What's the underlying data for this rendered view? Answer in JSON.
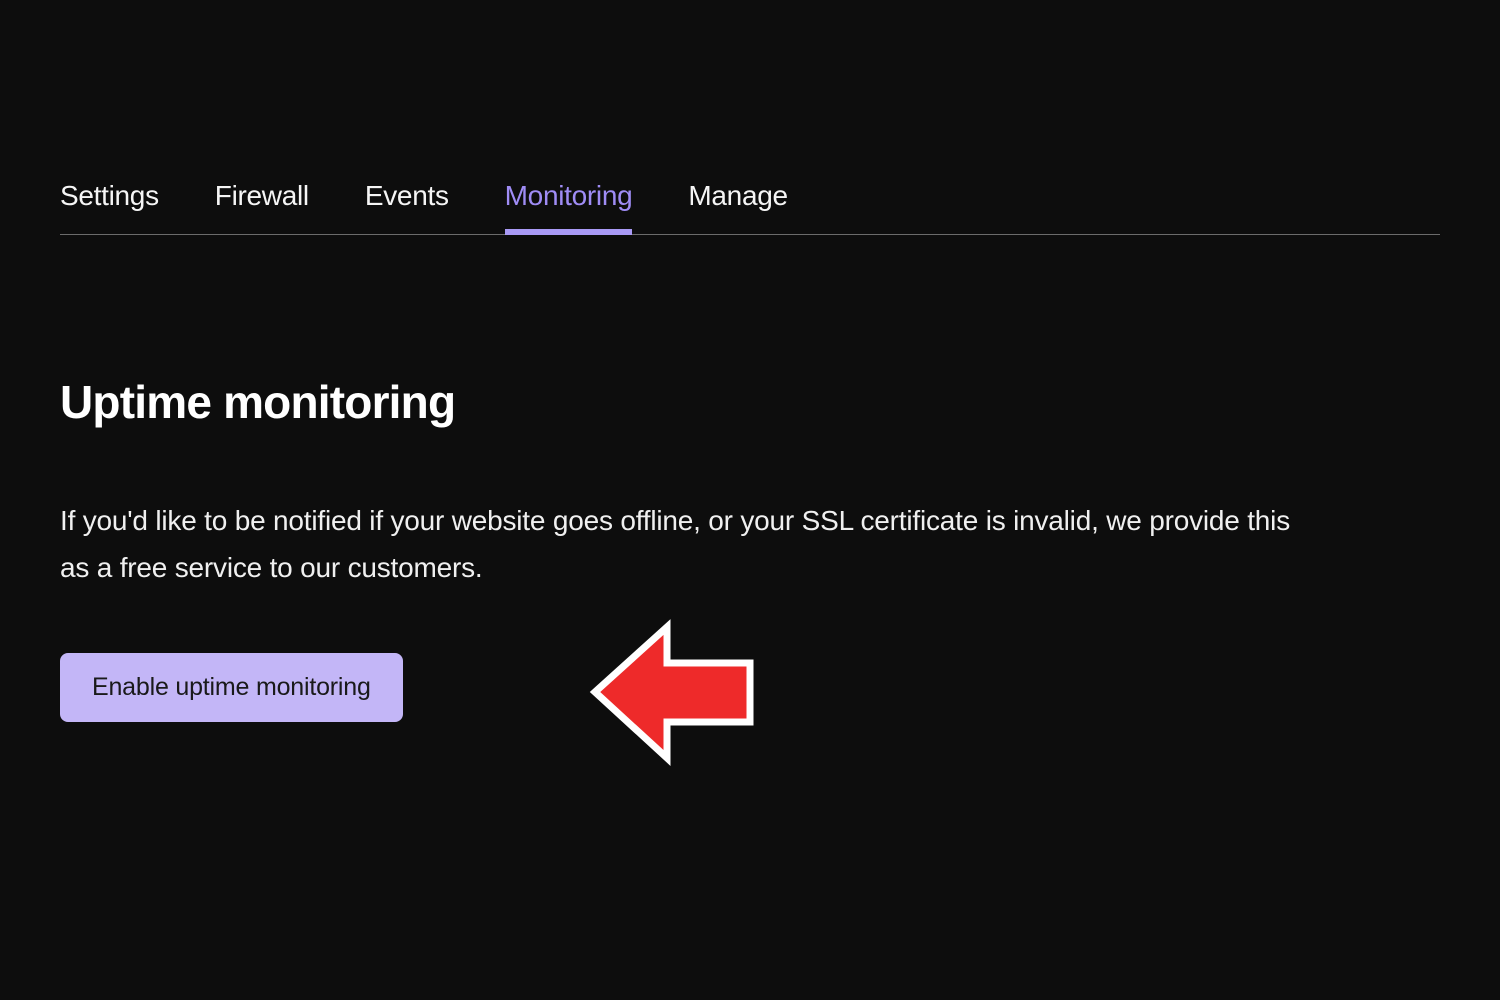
{
  "tabs": [
    {
      "label": "Settings",
      "active": false
    },
    {
      "label": "Firewall",
      "active": false
    },
    {
      "label": "Events",
      "active": false
    },
    {
      "label": "Monitoring",
      "active": true
    },
    {
      "label": "Manage",
      "active": false
    }
  ],
  "content": {
    "heading": "Uptime monitoring",
    "description": "If you'd like to be notified if your website goes offline, or your SSL certificate is invalid, we provide this as a free service to our customers.",
    "button_label": "Enable uptime monitoring"
  },
  "colors": {
    "accent": "#9f8cf5",
    "button_bg": "#c3b6f7",
    "annotation_fill": "#ee2a2a"
  }
}
